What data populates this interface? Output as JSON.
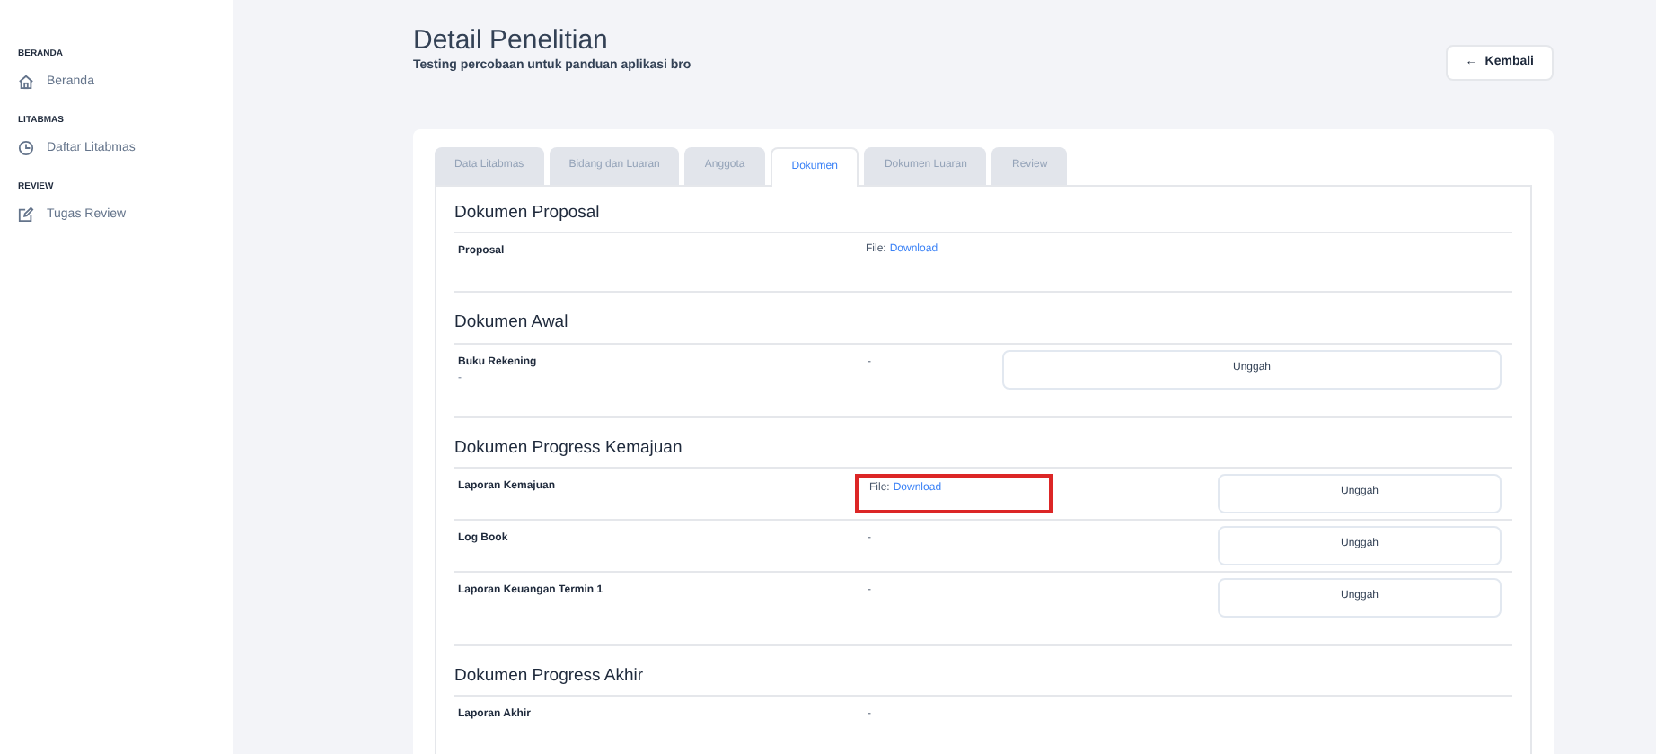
{
  "sidebar": {
    "groups": [
      {
        "heading": "BERANDA",
        "items": [
          {
            "label": "Beranda",
            "kind": "home"
          }
        ]
      },
      {
        "heading": "LITABMAS",
        "items": [
          {
            "label": "Daftar Litabmas",
            "kind": "clock"
          }
        ]
      },
      {
        "heading": "REVIEW",
        "items": [
          {
            "label": "Tugas Review",
            "kind": "edit"
          }
        ]
      }
    ]
  },
  "header": {
    "title": "Detail Penelitian",
    "subtitle": "Testing percobaan untuk panduan aplikasi bro",
    "back_button": {
      "icon": "←",
      "label": "Kembali"
    }
  },
  "tabs": [
    {
      "label": "Data Litabmas",
      "selected": false
    },
    {
      "label": "Bidang dan Luaran",
      "selected": false
    },
    {
      "label": "Anggota",
      "selected": false
    },
    {
      "label": "Dokumen",
      "selected": true
    },
    {
      "label": "Dokumen Luaran",
      "selected": false
    },
    {
      "label": "Review",
      "selected": false
    }
  ],
  "sections": [
    {
      "title": "Dokumen Proposal",
      "rows": [
        {
          "kind": "file",
          "label": "Proposal",
          "file_label": "File:",
          "link": "Download",
          "highlighted": false
        }
      ]
    },
    {
      "title": "Dokumen Awal",
      "rows": [
        {
          "kind": "upload_wide",
          "label": "Buku Rekening",
          "note": "-",
          "value": "-",
          "button": "Unggah"
        }
      ]
    },
    {
      "title": "Dokumen Progress Kemajuan",
      "rows": [
        {
          "kind": "upload",
          "label": "Laporan Kemajuan",
          "file_label": "File:",
          "link": "Download",
          "button": "Unggah",
          "highlighted": true
        },
        {
          "kind": "upload",
          "label": "Log Book",
          "value": "-",
          "button": "Unggah",
          "highlighted": false
        },
        {
          "kind": "upload",
          "label": "Laporan Keuangan Termin 1",
          "value": "-",
          "button": "Unggah",
          "highlighted": false
        }
      ]
    },
    {
      "title": "Dokumen Progress Akhir",
      "rows": [
        {
          "kind": "text",
          "label": "Laporan Akhir",
          "value": "-",
          "highlighted": false
        }
      ]
    }
  ]
}
